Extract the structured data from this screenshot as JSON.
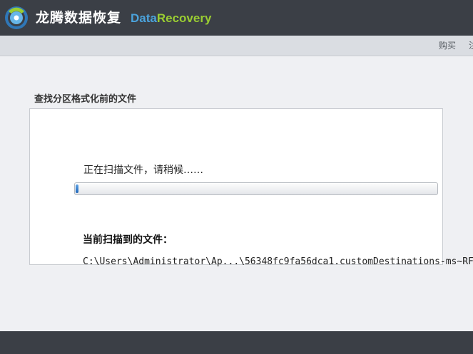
{
  "app": {
    "title_cn": "龙腾数据恢复",
    "title_en_part1": "Data",
    "title_en_part2": "Recovery"
  },
  "menu": {
    "buy_label": "购买",
    "more_label": "注"
  },
  "scan": {
    "section_title": "查找分区格式化前的文件",
    "status_text": "正在扫描文件，请稍候……",
    "progress_fraction": 0.008,
    "current_file_label": "当前扫描到的文件：",
    "current_file_path": "C:\\Users\\Administrator\\Ap...\\56348fc9fa56dca1.customDestinations-ms~RF"
  },
  "colors": {
    "titlebar_bg": "#3b3f46",
    "brand_blue": "#4ba3dc",
    "brand_green": "#9acd32",
    "progress_blue": "#1f66b8"
  }
}
